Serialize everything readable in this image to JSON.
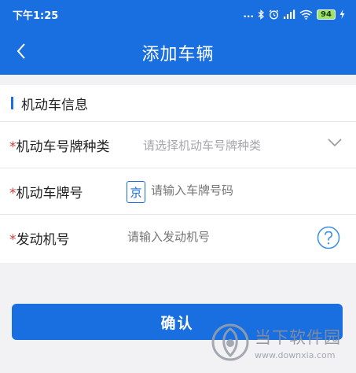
{
  "status_bar": {
    "time": "下午1:25",
    "dots": "...",
    "battery": "94"
  },
  "nav": {
    "title": "添加车辆"
  },
  "section": {
    "title": "机动车信息"
  },
  "form": {
    "plate_type": {
      "required_mark": "*",
      "label": "机动车号牌种类",
      "placeholder": "请选择机动车号牌种类"
    },
    "plate_number": {
      "required_mark": "*",
      "label": "机动车牌号",
      "prefix": "京",
      "placeholder": "请输入车牌号码"
    },
    "engine_number": {
      "required_mark": "*",
      "label": "发动机号",
      "placeholder": "请输入发动机号"
    }
  },
  "confirm_label": "确认",
  "watermark": {
    "name": "当下软件园",
    "url": "www.downxia.com"
  },
  "colors": {
    "primary": "#1a6fe0",
    "required": "#d23b3b",
    "background": "#f2f2f5"
  }
}
